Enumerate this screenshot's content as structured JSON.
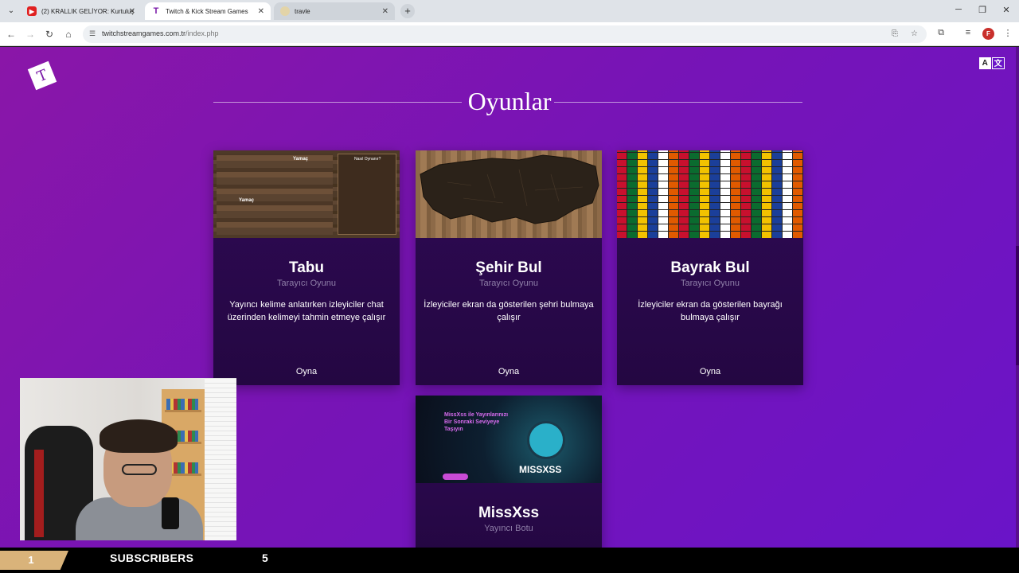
{
  "browser": {
    "tabs": [
      {
        "label": "(2) KRALLIK GELİYOR: Kurtuluş",
        "favicon": "youtube-icon",
        "active": false
      },
      {
        "label": "Twitch & Kick Stream Games",
        "favicon": "T",
        "active": true
      },
      {
        "label": "travle",
        "favicon": "globe-icon",
        "active": false
      }
    ],
    "url_host": "twitchstreamgames.com.tr",
    "url_path": "/index.php"
  },
  "page": {
    "logo_letter": "T",
    "translate_left": "A",
    "translate_right": "文",
    "heading": "Oyunlar",
    "cards": [
      {
        "title": "Tabu",
        "subtitle": "Tarayıcı Oyunu",
        "description": "Yayıncı kelime anlatırken izleyiciler chat üzerinden kelimeyi tahmin etmeye çalışır",
        "play": "Oyna",
        "thumb_label": "Yamaç",
        "thumb_label2": "Nasıl Oynanır?"
      },
      {
        "title": "Şehir Bul",
        "subtitle": "Tarayıcı Oyunu",
        "description": "İzleyiciler ekran da gösterilen şehri bulmaya çalışır",
        "play": "Oyna"
      },
      {
        "title": "Bayrak Bul",
        "subtitle": "Tarayıcı Oyunu",
        "description": "İzleyiciler ekran da gösterilen bayrağı bulmaya çalışır",
        "play": "Oyna"
      },
      {
        "title": "MissXss",
        "subtitle": "Yayıncı Botu",
        "thumb_headline": "MissXss ile Yayınlarınızı Bir Sonraki Seviyeye Taşıyın",
        "thumb_brand": "MISSXSS"
      }
    ]
  },
  "overlay": {
    "sub_count": "1",
    "label": "SUBSCRIBERS",
    "goal": "5"
  },
  "colors": {
    "page_bg_start": "#8a16a8",
    "page_bg_end": "#6a14c8",
    "card_bg": "#2f0a55",
    "subscriber_badge": "#d9b37a"
  }
}
